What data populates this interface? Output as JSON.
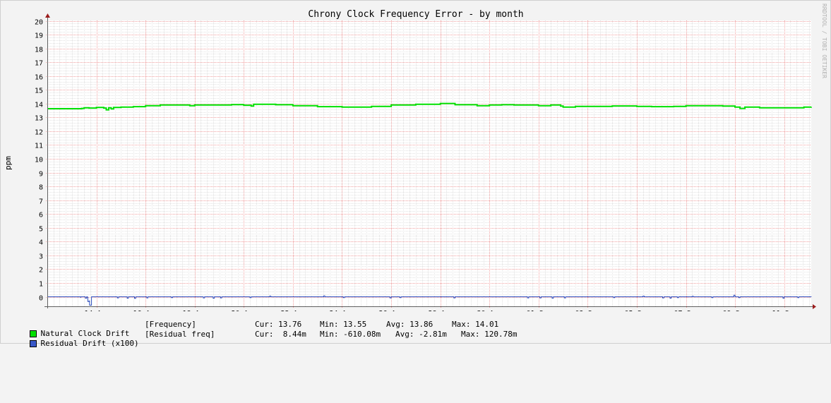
{
  "chart_data": {
    "type": "line",
    "title": "Chrony Clock Frequency Error - by month",
    "ylabel": "ppm",
    "watermark": "RRDTOOL / TOBI OETIKER",
    "ylim": [
      0,
      20
    ],
    "yticks": [
      "0",
      "1",
      "2",
      "3",
      "4",
      "5",
      "6",
      "7",
      "8",
      "9",
      "10",
      "11",
      "12",
      "13",
      "14",
      "15",
      "16",
      "17",
      "18",
      "19",
      "20"
    ],
    "x_range_days": [
      12.0,
      43.1
    ],
    "xticks": [
      {
        "day": 14,
        "label": "14 Aug"
      },
      {
        "day": 16,
        "label": "16 Aug"
      },
      {
        "day": 18,
        "label": "18 Aug"
      },
      {
        "day": 20,
        "label": "20 Aug"
      },
      {
        "day": 22,
        "label": "22 Aug"
      },
      {
        "day": 24,
        "label": "24 Aug"
      },
      {
        "day": 26,
        "label": "26 Aug"
      },
      {
        "day": 28,
        "label": "28 Aug"
      },
      {
        "day": 30,
        "label": "30 Aug"
      },
      {
        "day": 32,
        "label": "01 Sep"
      },
      {
        "day": 34,
        "label": "03 Sep"
      },
      {
        "day": 36,
        "label": "05 Sep"
      },
      {
        "day": 38,
        "label": "07 Sep"
      },
      {
        "day": 40,
        "label": "09 Sep"
      },
      {
        "day": 42,
        "label": "11 Sep"
      }
    ],
    "series": [
      {
        "name": "Natural Clock Drift",
        "color": "#00e000",
        "points": [
          [
            12.0,
            13.63
          ],
          [
            13.2,
            13.63
          ],
          [
            13.4,
            13.65
          ],
          [
            13.5,
            13.7
          ],
          [
            13.7,
            13.68
          ],
          [
            14.0,
            13.72
          ],
          [
            14.3,
            13.68
          ],
          [
            14.4,
            13.55
          ],
          [
            14.5,
            13.7
          ],
          [
            14.6,
            13.62
          ],
          [
            14.7,
            13.72
          ],
          [
            15.0,
            13.75
          ],
          [
            15.5,
            13.78
          ],
          [
            16.0,
            13.85
          ],
          [
            16.6,
            13.9
          ],
          [
            17.5,
            13.9
          ],
          [
            17.8,
            13.85
          ],
          [
            18.0,
            13.9
          ],
          [
            19.5,
            13.93
          ],
          [
            20.0,
            13.88
          ],
          [
            20.3,
            13.82
          ],
          [
            20.4,
            13.95
          ],
          [
            21.0,
            13.95
          ],
          [
            21.3,
            13.92
          ],
          [
            22.0,
            13.85
          ],
          [
            23.0,
            13.78
          ],
          [
            24.0,
            13.75
          ],
          [
            25.2,
            13.8
          ],
          [
            26.0,
            13.9
          ],
          [
            27.0,
            13.95
          ],
          [
            28.0,
            14.01
          ],
          [
            28.6,
            13.92
          ],
          [
            29.5,
            13.85
          ],
          [
            30.0,
            13.9
          ],
          [
            30.5,
            13.92
          ],
          [
            31.0,
            13.9
          ],
          [
            32.0,
            13.85
          ],
          [
            32.5,
            13.9
          ],
          [
            32.9,
            13.82
          ],
          [
            33.0,
            13.75
          ],
          [
            33.5,
            13.8
          ],
          [
            35.0,
            13.83
          ],
          [
            36.0,
            13.8
          ],
          [
            36.6,
            13.78
          ],
          [
            37.5,
            13.8
          ],
          [
            38.0,
            13.85
          ],
          [
            39.0,
            13.85
          ],
          [
            39.5,
            13.82
          ],
          [
            40.0,
            13.75
          ],
          [
            40.2,
            13.65
          ],
          [
            40.4,
            13.75
          ],
          [
            41.0,
            13.7
          ],
          [
            42.5,
            13.7
          ],
          [
            42.8,
            13.75
          ],
          [
            43.1,
            13.76
          ]
        ]
      },
      {
        "name": "Residual Drift (x100)",
        "color": "#2f4fbf",
        "points": [
          [
            12.0,
            0.0
          ],
          [
            13.2,
            0.0
          ],
          [
            13.35,
            -0.08
          ],
          [
            13.45,
            0.0
          ],
          [
            13.3,
            0.0
          ],
          [
            13.35,
            0.0
          ],
          [
            13.4,
            0.0
          ],
          [
            13.5,
            0.0
          ],
          [
            13.55,
            -0.1
          ],
          [
            13.6,
            0.0
          ],
          [
            13.3,
            0.0
          ],
          [
            13.6,
            0.0
          ],
          [
            13.62,
            -0.02
          ],
          [
            13.65,
            -0.35
          ],
          [
            13.7,
            -0.3
          ],
          [
            13.72,
            -0.61
          ],
          [
            13.78,
            -0.61
          ],
          [
            13.8,
            0.0
          ],
          [
            14.8,
            0.0
          ],
          [
            14.85,
            -0.08
          ],
          [
            14.9,
            0.0
          ],
          [
            15.2,
            0.0
          ],
          [
            15.25,
            -0.1
          ],
          [
            15.3,
            0.0
          ],
          [
            15.5,
            0.0
          ],
          [
            15.55,
            -0.12
          ],
          [
            15.6,
            0.0
          ],
          [
            16.0,
            0.0
          ],
          [
            16.05,
            -0.08
          ],
          [
            16.1,
            0.0
          ],
          [
            17.0,
            0.0
          ],
          [
            17.05,
            -0.06
          ],
          [
            17.1,
            0.0
          ],
          [
            18.3,
            0.0
          ],
          [
            18.35,
            -0.08
          ],
          [
            18.4,
            0.0
          ],
          [
            18.7,
            0.0
          ],
          [
            18.75,
            -0.1
          ],
          [
            18.8,
            0.0
          ],
          [
            19.0,
            0.0
          ],
          [
            19.05,
            -0.08
          ],
          [
            19.1,
            0.0
          ],
          [
            20.2,
            0.0
          ],
          [
            20.25,
            -0.06
          ],
          [
            20.3,
            0.0
          ],
          [
            21.0,
            0.0
          ],
          [
            21.05,
            0.05
          ],
          [
            21.1,
            0.0
          ],
          [
            23.2,
            0.0
          ],
          [
            23.25,
            0.06
          ],
          [
            23.3,
            0.0
          ],
          [
            24.0,
            0.0
          ],
          [
            24.05,
            -0.06
          ],
          [
            24.1,
            0.0
          ],
          [
            25.9,
            0.0
          ],
          [
            25.95,
            -0.08
          ],
          [
            26.0,
            0.0
          ],
          [
            26.3,
            0.0
          ],
          [
            26.35,
            -0.06
          ],
          [
            26.4,
            0.0
          ],
          [
            28.5,
            0.0
          ],
          [
            28.55,
            -0.08
          ],
          [
            28.6,
            0.0
          ],
          [
            31.5,
            0.0
          ],
          [
            31.55,
            -0.08
          ],
          [
            31.6,
            0.0
          ],
          [
            32.0,
            0.0
          ],
          [
            32.05,
            -0.08
          ],
          [
            32.1,
            0.0
          ],
          [
            32.5,
            0.0
          ],
          [
            32.55,
            -0.1
          ],
          [
            32.6,
            0.0
          ],
          [
            33.0,
            0.0
          ],
          [
            33.05,
            -0.08
          ],
          [
            33.1,
            0.0
          ],
          [
            35.0,
            0.0
          ],
          [
            35.05,
            -0.06
          ],
          [
            35.1,
            0.0
          ],
          [
            36.2,
            0.0
          ],
          [
            36.25,
            0.05
          ],
          [
            36.3,
            0.0
          ],
          [
            37.0,
            0.0
          ],
          [
            37.05,
            -0.08
          ],
          [
            37.1,
            0.0
          ],
          [
            37.3,
            0.0
          ],
          [
            37.35,
            -0.1
          ],
          [
            37.4,
            0.0
          ],
          [
            37.6,
            0.0
          ],
          [
            37.65,
            -0.06
          ],
          [
            37.7,
            0.0
          ],
          [
            38.2,
            0.0
          ],
          [
            38.25,
            0.04
          ],
          [
            38.3,
            0.0
          ],
          [
            39.0,
            0.0
          ],
          [
            39.05,
            -0.06
          ],
          [
            39.1,
            0.0
          ],
          [
            39.9,
            0.0
          ],
          [
            39.95,
            0.12
          ],
          [
            40.0,
            0.0
          ],
          [
            40.1,
            0.0
          ],
          [
            40.15,
            -0.06
          ],
          [
            40.2,
            0.0
          ],
          [
            41.9,
            0.0
          ],
          [
            41.95,
            -0.1
          ],
          [
            42.0,
            0.0
          ],
          [
            42.5,
            0.0
          ],
          [
            42.55,
            -0.06
          ],
          [
            42.6,
            0.0
          ],
          [
            43.1,
            0.01
          ]
        ]
      }
    ]
  },
  "legend": [
    {
      "label": "Natural Clock Drift",
      "color": "#00e000",
      "tag": "[Frequency]",
      "cur": "Cur: 13.76",
      "min": "Min: 13.55",
      "avg": "Avg: 13.86",
      "max": "Max: 14.01"
    },
    {
      "label": "Residual Drift (x100)",
      "color": "#3858c8",
      "tag": "[Residual freq]",
      "cur": "Cur:  8.44m",
      "min": "Min: -610.08m",
      "avg": "Avg: -2.81m",
      "max": "Max: 120.78m"
    }
  ]
}
